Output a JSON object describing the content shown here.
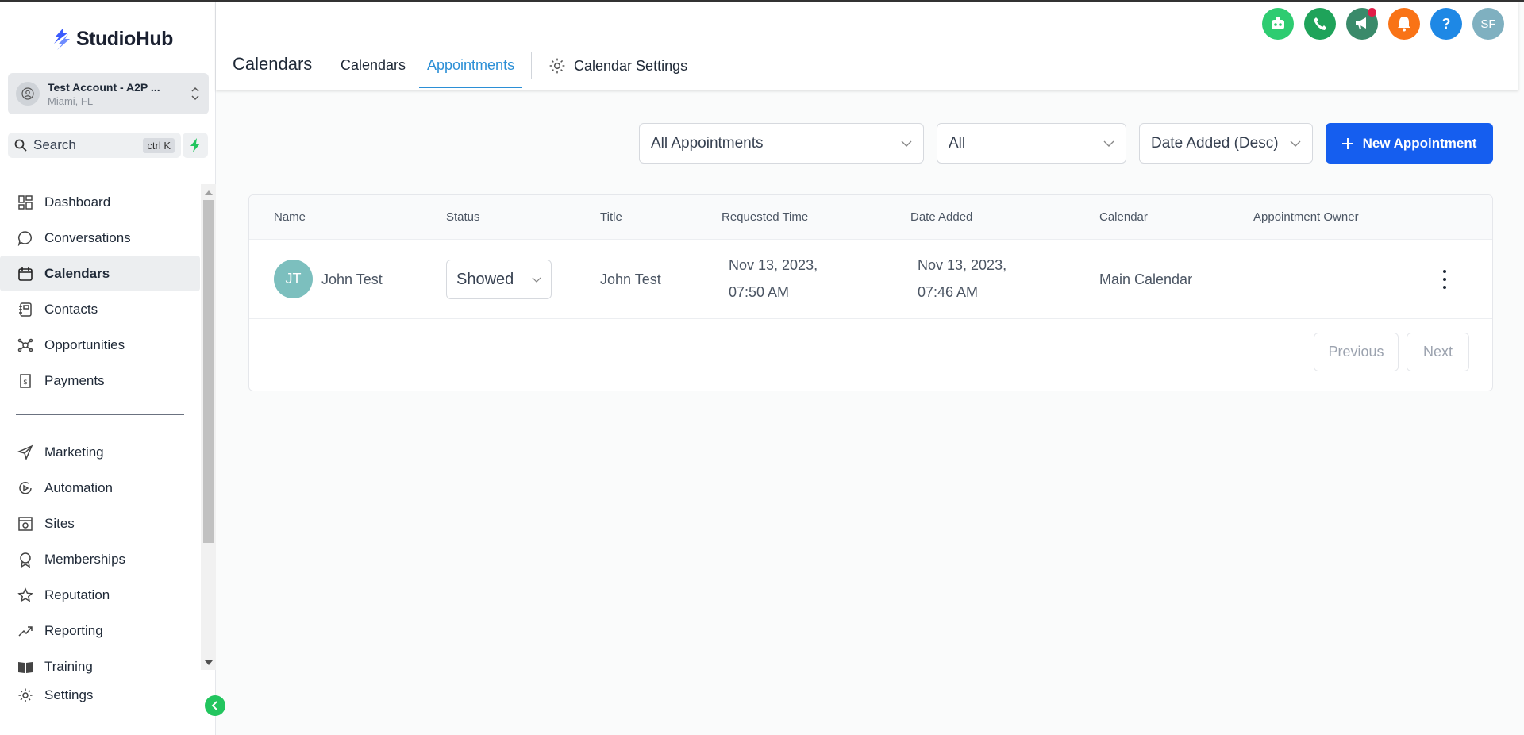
{
  "brand": {
    "name": "StudioHub"
  },
  "account": {
    "name": "Test Account - A2P ...",
    "location": "Miami, FL"
  },
  "search": {
    "label": "Search",
    "shortcut": "ctrl K"
  },
  "sidebar": {
    "primary": [
      {
        "label": "Dashboard",
        "icon": "dashboard-icon"
      },
      {
        "label": "Conversations",
        "icon": "chat-icon"
      },
      {
        "label": "Calendars",
        "icon": "calendar-icon",
        "active": true
      },
      {
        "label": "Contacts",
        "icon": "contacts-icon"
      },
      {
        "label": "Opportunities",
        "icon": "opportunities-icon"
      },
      {
        "label": "Payments",
        "icon": "payments-icon"
      }
    ],
    "secondary": [
      {
        "label": "Marketing",
        "icon": "send-icon"
      },
      {
        "label": "Automation",
        "icon": "automation-icon"
      },
      {
        "label": "Sites",
        "icon": "sites-icon"
      },
      {
        "label": "Memberships",
        "icon": "award-icon"
      },
      {
        "label": "Reputation",
        "icon": "star-icon"
      },
      {
        "label": "Reporting",
        "icon": "trend-icon"
      },
      {
        "label": "Training",
        "icon": "book-icon"
      }
    ],
    "settings": "Settings"
  },
  "header": {
    "title": "Calendars",
    "tabs": [
      {
        "label": "Calendars",
        "active": false
      },
      {
        "label": "Appointments",
        "active": true
      }
    ],
    "settings_tab": "Calendar Settings",
    "top_icons": [
      {
        "name": "bot-icon",
        "color": "#2ecc71"
      },
      {
        "name": "phone-icon",
        "color": "#1fa35a"
      },
      {
        "name": "megaphone-icon",
        "color": "#3a8a6a"
      },
      {
        "name": "bell-icon",
        "color": "#f97316"
      },
      {
        "name": "help-icon",
        "color": "#1e88e5",
        "text": "?"
      },
      {
        "name": "user-avatar",
        "color": "#7fb0c0",
        "text": "SF"
      }
    ]
  },
  "filters": {
    "type": "All Appointments",
    "status": "All",
    "sort": "Date Added (Desc)",
    "new_button": "New Appointment"
  },
  "table": {
    "columns": [
      "Name",
      "Status",
      "Title",
      "Requested Time",
      "Date Added",
      "Calendar",
      "Appointment Owner"
    ],
    "rows": [
      {
        "initials": "JT",
        "name": "John Test",
        "status": "Showed",
        "title": "John Test",
        "requested_date": "Nov 13, 2023,",
        "requested_time": "07:50 AM",
        "added_date": "Nov 13, 2023,",
        "added_time": "07:46 AM",
        "calendar": "Main Calendar",
        "owner": ""
      }
    ]
  },
  "pagination": {
    "previous": "Previous",
    "next": "Next"
  },
  "colors": {
    "accent": "#155eef",
    "tab_active": "#2b8fd6",
    "avatar": "#7cbfbe"
  }
}
